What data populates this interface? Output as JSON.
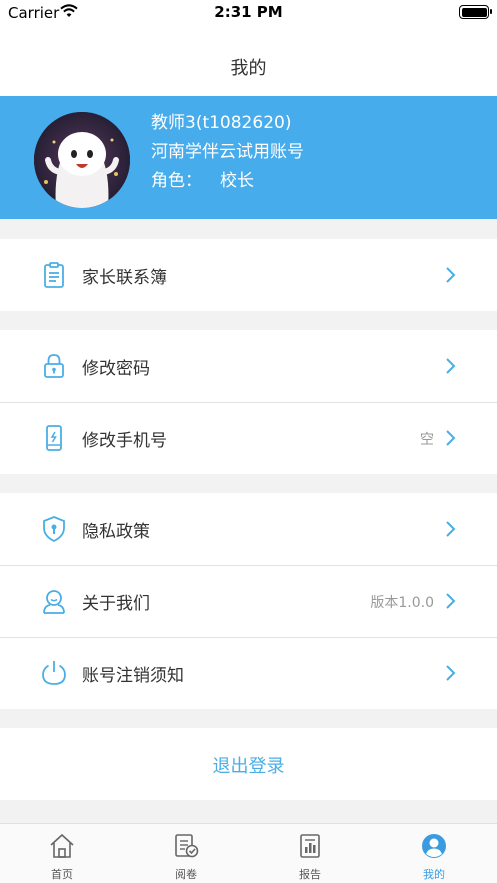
{
  "status_bar": {
    "carrier": "Carrier",
    "time": "2:31 PM"
  },
  "nav": {
    "title": "我的"
  },
  "profile": {
    "name": "教师3(t1082620)",
    "org": "河南学伴云试用账号",
    "role_label": "角色：",
    "role_value": "校长"
  },
  "menu": {
    "parent_contact": {
      "label": "家长联系簿",
      "icon": "clipboard-icon"
    },
    "change_password": {
      "label": "修改密码",
      "icon": "lock-icon"
    },
    "change_phone": {
      "label": "修改手机号",
      "value": "空",
      "icon": "phone-icon"
    },
    "privacy": {
      "label": "隐私政策",
      "icon": "shield-icon"
    },
    "about": {
      "label": "关于我们",
      "value": "版本1.0.0",
      "icon": "user-support-icon"
    },
    "cancel_account": {
      "label": "账号注销须知",
      "icon": "power-icon"
    }
  },
  "logout": {
    "label": "退出登录"
  },
  "tabs": [
    {
      "label": "首页",
      "icon": "home-icon"
    },
    {
      "label": "阅卷",
      "icon": "grading-icon"
    },
    {
      "label": "报告",
      "icon": "report-icon"
    },
    {
      "label": "我的",
      "icon": "profile-icon"
    }
  ],
  "colors": {
    "accent": "#47acec",
    "link": "#4aaee6",
    "tab_active": "#3a9be0"
  }
}
